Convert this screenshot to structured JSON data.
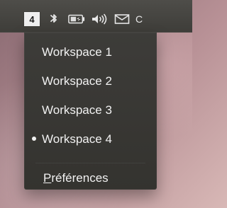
{
  "panel": {
    "workspace_number": "4",
    "icons": [
      "bluetooth-icon",
      "battery-icon",
      "volume-icon",
      "mail-icon"
    ],
    "cut_text": "C"
  },
  "menu": {
    "items": [
      {
        "label": "Workspace 1",
        "active": false
      },
      {
        "label": "Workspace 2",
        "active": false
      },
      {
        "label": "Workspace 3",
        "active": false
      },
      {
        "label": "Workspace 4",
        "active": true
      }
    ],
    "preferences": {
      "mnemonic": "P",
      "rest": "références"
    }
  },
  "colors": {
    "panel": "#3e3d39",
    "menu": "#34332f",
    "text": "#f1f1f1",
    "badge_bg": "#efefef",
    "badge_text": "#1b1b1b"
  }
}
